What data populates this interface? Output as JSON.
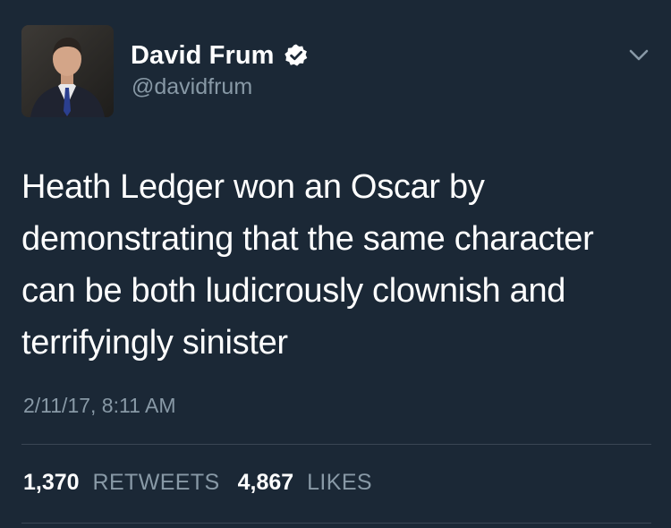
{
  "author": {
    "display_name": "David Frum",
    "handle": "@davidfrum",
    "verified": true
  },
  "tweet": {
    "text_lines": [
      "Heath Ledger won an Oscar by",
      "demonstrating that the same character",
      "can be both ludicrously clownish and",
      "terrifyingly sinister"
    ],
    "timestamp": "2/11/17, 8:11 AM"
  },
  "stats": {
    "retweets_count": "1,370",
    "retweets_label": "RETWEETS",
    "likes_count": "4,867",
    "likes_label": "LIKES"
  },
  "colors": {
    "background": "#1b2836",
    "secondary_text": "#8899a6",
    "primary_text": "#ffffff"
  },
  "icons": {
    "verified": "verified-badge-icon",
    "menu": "chevron-down-icon"
  }
}
